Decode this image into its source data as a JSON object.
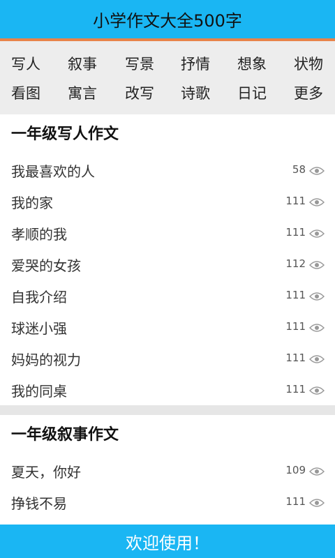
{
  "header": {
    "title": "小学作文大全500字"
  },
  "categories": {
    "row1": [
      "写人",
      "叙事",
      "写景",
      "抒情",
      "想象",
      "状物"
    ],
    "row2": [
      "看图",
      "寓言",
      "改写",
      "诗歌",
      "日记",
      "更多"
    ]
  },
  "sections": [
    {
      "title": "一年级写人作文",
      "items": [
        {
          "name": "我最喜欢的人",
          "views": "58"
        },
        {
          "name": "我的家",
          "views": "111"
        },
        {
          "name": "孝顺的我",
          "views": "111"
        },
        {
          "name": "爱哭的女孩",
          "views": "112"
        },
        {
          "name": "自我介绍",
          "views": "111"
        },
        {
          "name": "球迷小强",
          "views": "111"
        },
        {
          "name": "妈妈的视力",
          "views": "111"
        },
        {
          "name": "我的同桌",
          "views": "111"
        }
      ]
    },
    {
      "title": "一年级叙事作文",
      "items": [
        {
          "name": "夏天，你好",
          "views": "109"
        },
        {
          "name": "挣钱不易",
          "views": "111"
        }
      ]
    }
  ],
  "footer": {
    "message": "欢迎使用！"
  },
  "colors": {
    "accent": "#1ab6f3",
    "underline": "#e8834a",
    "category_bg": "#ededed"
  },
  "icons": {
    "views": "eye-icon"
  }
}
